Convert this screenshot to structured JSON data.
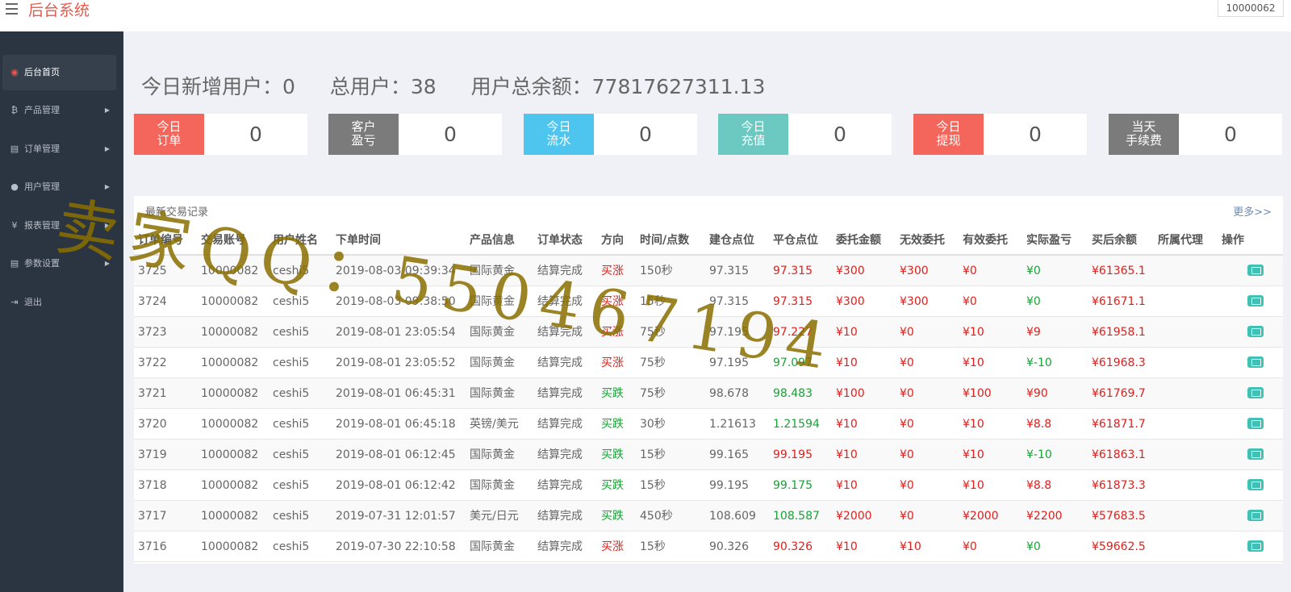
{
  "header": {
    "brand": "后台系统",
    "user_id": "10000062"
  },
  "sidebar": {
    "items": [
      {
        "label": "后台首页",
        "icon": "dashboard-icon",
        "glyph": "◉",
        "active": true
      },
      {
        "label": "产品管理",
        "icon": "bitcoin-icon",
        "glyph": "₿",
        "arrow": "▶"
      },
      {
        "label": "订单管理",
        "icon": "copy-icon",
        "glyph": "▤",
        "arrow": "▶"
      },
      {
        "label": "用户管理",
        "icon": "user-icon",
        "glyph": "●",
        "arrow": "▶"
      },
      {
        "label": "报表管理",
        "icon": "yen-icon",
        "glyph": "¥",
        "arrow": "▶"
      },
      {
        "label": "参数设置",
        "icon": "copy-icon",
        "glyph": "▤",
        "arrow": "▶"
      },
      {
        "label": "退出",
        "icon": "logout-icon",
        "glyph": "⇥"
      }
    ]
  },
  "stats": {
    "new_users": "今日新增用户：0",
    "total_users": "总用户：38",
    "total_balance": "用户总余额：77817627311.13"
  },
  "cards": [
    {
      "line1": "今日",
      "line2": "订单",
      "value": "0",
      "color": "#f4665b"
    },
    {
      "line1": "客户",
      "line2": "盈亏",
      "value": "0",
      "color": "#7b7b7b"
    },
    {
      "line1": "今日",
      "line2": "流水",
      "value": "0",
      "color": "#4ec5ef"
    },
    {
      "line1": "今日",
      "line2": "充值",
      "value": "0",
      "color": "#6bc9c2"
    },
    {
      "line1": "今日",
      "line2": "提现",
      "value": "0",
      "color": "#f4665b"
    },
    {
      "line1": "当天",
      "line2": "手续费",
      "value": "0",
      "color": "#7b7b7b"
    }
  ],
  "panel": {
    "title": "最新交易记录",
    "more": "更多>>"
  },
  "table": {
    "columns": [
      "订单编号",
      "交易账号",
      "用户姓名",
      "下单时间",
      "产品信息",
      "订单状态",
      "方向",
      "时间/点数",
      "建仓点位",
      "平仓点位",
      "委托金额",
      "无效委托",
      "有效委托",
      "实际盈亏",
      "买后余额",
      "所属代理",
      "操作"
    ],
    "rows": [
      [
        "3725",
        "10000082",
        "ceshi5",
        "2019-08-03 09:39:34",
        "国际黄金",
        "结算完成",
        "买涨",
        "150秒",
        "97.315",
        "97.315",
        "¥300",
        "¥300",
        "¥0",
        "¥0",
        "¥61365.1",
        ""
      ],
      [
        "3724",
        "10000082",
        "ceshi5",
        "2019-08-03 09:38:50",
        "国际黄金",
        "结算完成",
        "买涨",
        "15秒",
        "97.315",
        "97.315",
        "¥300",
        "¥300",
        "¥0",
        "¥0",
        "¥61671.1",
        ""
      ],
      [
        "3723",
        "10000082",
        "ceshi5",
        "2019-08-01 23:05:54",
        "国际黄金",
        "结算完成",
        "买涨",
        "75秒",
        "97.195",
        "97.227",
        "¥10",
        "¥0",
        "¥10",
        "¥9",
        "¥61958.1",
        ""
      ],
      [
        "3722",
        "10000082",
        "ceshi5",
        "2019-08-01 23:05:52",
        "国际黄金",
        "结算完成",
        "买涨",
        "75秒",
        "97.195",
        "97.097",
        "¥10",
        "¥0",
        "¥10",
        "¥-10",
        "¥61968.3",
        ""
      ],
      [
        "3721",
        "10000082",
        "ceshi5",
        "2019-08-01 06:45:31",
        "国际黄金",
        "结算完成",
        "买跌",
        "75秒",
        "98.678",
        "98.483",
        "¥100",
        "¥0",
        "¥100",
        "¥90",
        "¥61769.7",
        ""
      ],
      [
        "3720",
        "10000082",
        "ceshi5",
        "2019-08-01 06:45:18",
        "英镑/美元",
        "结算完成",
        "买跌",
        "30秒",
        "1.21613",
        "1.21594",
        "¥10",
        "¥0",
        "¥10",
        "¥8.8",
        "¥61871.7",
        ""
      ],
      [
        "3719",
        "10000082",
        "ceshi5",
        "2019-08-01 06:12:45",
        "国际黄金",
        "结算完成",
        "买跌",
        "15秒",
        "99.165",
        "99.195",
        "¥10",
        "¥0",
        "¥10",
        "¥-10",
        "¥61863.1",
        ""
      ],
      [
        "3718",
        "10000082",
        "ceshi5",
        "2019-08-01 06:12:42",
        "国际黄金",
        "结算完成",
        "买跌",
        "15秒",
        "99.195",
        "99.175",
        "¥10",
        "¥0",
        "¥10",
        "¥8.8",
        "¥61873.3",
        ""
      ],
      [
        "3717",
        "10000082",
        "ceshi5",
        "2019-07-31 12:01:57",
        "美元/日元",
        "结算完成",
        "买跌",
        "450秒",
        "108.609",
        "108.587",
        "¥2000",
        "¥0",
        "¥2000",
        "¥2200",
        "¥57683.5",
        ""
      ],
      [
        "3716",
        "10000082",
        "ceshi5",
        "2019-07-30 22:10:58",
        "国际黄金",
        "结算完成",
        "买涨",
        "15秒",
        "90.326",
        "90.326",
        "¥10",
        "¥10",
        "¥0",
        "¥0",
        "¥59662.5",
        ""
      ]
    ]
  },
  "watermark": "卖家QQ：550467194"
}
